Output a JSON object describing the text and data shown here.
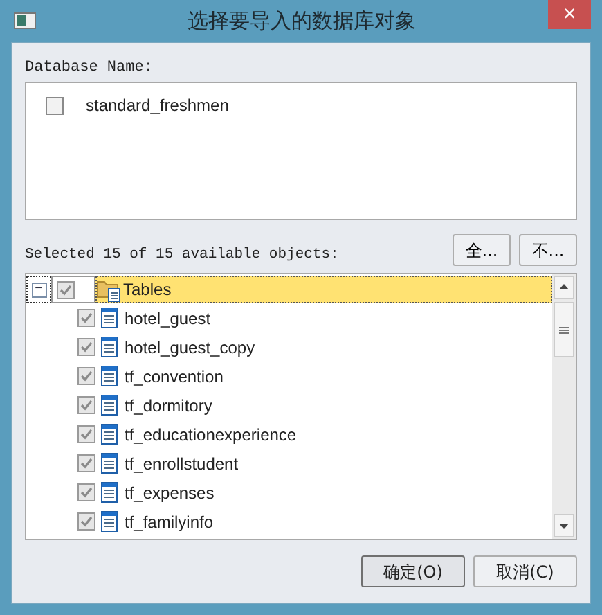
{
  "window": {
    "title": "选择要导入的数据库对象",
    "close": "×"
  },
  "database_label": "Database Name:",
  "databases": [
    {
      "name": "standard_freshmen",
      "checked": false
    }
  ],
  "select_all_button": "全...",
  "select_none_button": "不...",
  "selected_label": "Selected 15 of 15 available objects:",
  "tree": {
    "label": "Tables",
    "expander": "−",
    "checked": true,
    "selected": true,
    "children": [
      {
        "label": "hotel_guest",
        "checked": true
      },
      {
        "label": "hotel_guest_copy",
        "checked": true
      },
      {
        "label": "tf_convention",
        "checked": true
      },
      {
        "label": "tf_dormitory",
        "checked": true
      },
      {
        "label": "tf_educationexperience",
        "checked": true
      },
      {
        "label": "tf_enrollstudent",
        "checked": true
      },
      {
        "label": "tf_expenses",
        "checked": true
      },
      {
        "label": "tf_familyinfo",
        "checked": true
      }
    ]
  },
  "buttons": [
    "确定(O)",
    "取消(C)"
  ]
}
